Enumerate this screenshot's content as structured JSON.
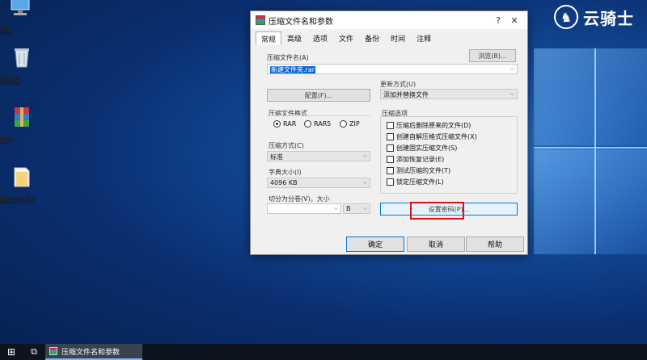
{
  "desktop": {
    "icons": [
      {
        "label": "网络",
        "icon": "network-icon"
      },
      {
        "label": "回收站",
        "icon": "recycle-bin-icon"
      },
      {
        "label": "软件",
        "icon": "winrar-icon"
      },
      {
        "label": "新建文件夹",
        "icon": "folder-icon"
      }
    ],
    "watermark": "云骑士"
  },
  "dialog": {
    "title": "压缩文件名和参数",
    "tabs": [
      "常规",
      "高级",
      "选项",
      "文件",
      "备份",
      "时间",
      "注释"
    ],
    "active_tab": "常规",
    "archive_name_label": "压缩文件名(A)",
    "browse_button": "浏览(B)...",
    "archive_name_value": "新建文件夹.rar",
    "update_mode_label": "更新方式(U)",
    "update_mode_value": "添加并替换文件",
    "profiles_button": "配置(F)...",
    "format_label": "压缩文件格式",
    "formats": [
      {
        "label": "RAR",
        "checked": true
      },
      {
        "label": "RAR5",
        "checked": false
      },
      {
        "label": "ZIP",
        "checked": false
      }
    ],
    "method_label": "压缩方式(C)",
    "method_value": "标准",
    "dict_label": "字典大小(I)",
    "dict_value": "4096 KB",
    "split_label": "切分为分卷(V)，大小",
    "split_value": "",
    "split_unit": "B",
    "options_label": "压缩选项",
    "options": [
      {
        "label": "压缩后删除原来的文件(D)",
        "checked": false
      },
      {
        "label": "创建自解压格式压缩文件(X)",
        "checked": false
      },
      {
        "label": "创建固实压缩文件(S)",
        "checked": false
      },
      {
        "label": "添加恢复记录(E)",
        "checked": false
      },
      {
        "label": "测试压缩的文件(T)",
        "checked": false
      },
      {
        "label": "锁定压缩文件(L)",
        "checked": false
      }
    ],
    "set_password_button": "设置密码(P)...",
    "ok_button": "确定",
    "cancel_button": "取消",
    "help_button": "帮助"
  },
  "taskbar": {
    "active_app": "压缩文件名和参数"
  }
}
